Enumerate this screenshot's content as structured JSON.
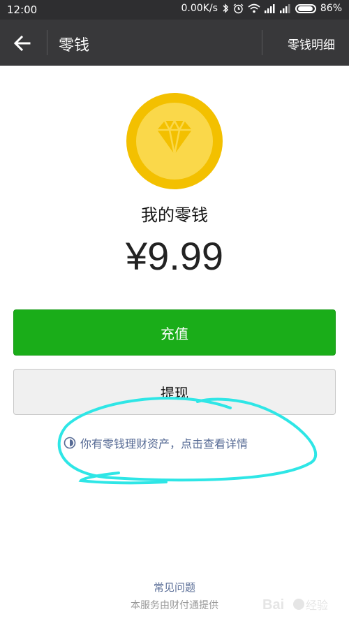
{
  "status_bar": {
    "time": "12:00",
    "network_speed": "0.00K/s",
    "battery": "86%",
    "icons": [
      "bluetooth-icon",
      "alarm-icon",
      "wifi-icon",
      "signal-icon",
      "signal-icon",
      "battery-icon"
    ]
  },
  "nav": {
    "title": "零钱",
    "right_action": "零钱明细"
  },
  "wallet": {
    "coin_icon": "diamond-coin-icon",
    "label": "我的零钱",
    "amount": "¥9.99"
  },
  "buttons": {
    "recharge": "充值",
    "withdraw": "提现"
  },
  "info_link": "你有零钱理财资产，点击查看详情",
  "footer": {
    "faq": "常见问题",
    "provider": "本服务由财付通提供"
  },
  "colors": {
    "status_bar": "#2e2e30",
    "nav_bar": "#38383a",
    "primary_green": "#1aad19",
    "link_blue": "#576b95",
    "coin_outer": "#f3c000",
    "coin_inner": "#fad84a",
    "annotation_cyan": "#2ee6e6"
  }
}
